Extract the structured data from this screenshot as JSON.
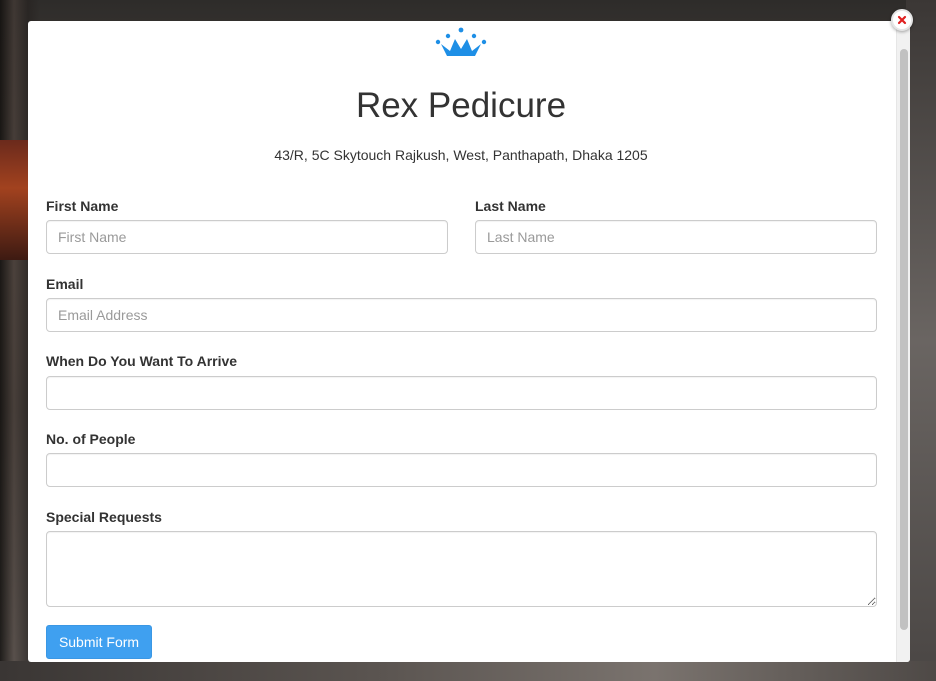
{
  "business": {
    "name": "Rex Pedicure",
    "address": "43/R, 5C Skytouch Rajkush, West, Panthapath, Dhaka 1205"
  },
  "logo_icon": "crown-icon",
  "form": {
    "first_name": {
      "label": "First Name",
      "placeholder": "First Name",
      "value": ""
    },
    "last_name": {
      "label": "Last Name",
      "placeholder": "Last Name",
      "value": ""
    },
    "email": {
      "label": "Email",
      "placeholder": "Email Address",
      "value": ""
    },
    "arrival": {
      "label": "When Do You Want To Arrive",
      "placeholder": "",
      "value": ""
    },
    "people": {
      "label": "No. of People",
      "placeholder": "",
      "value": ""
    },
    "requests": {
      "label": "Special Requests",
      "placeholder": "",
      "value": ""
    },
    "submit_label": "Submit Form"
  },
  "colors": {
    "accent": "#3fa0f0",
    "logo": "#1e8fe6",
    "close": "#e02020"
  }
}
